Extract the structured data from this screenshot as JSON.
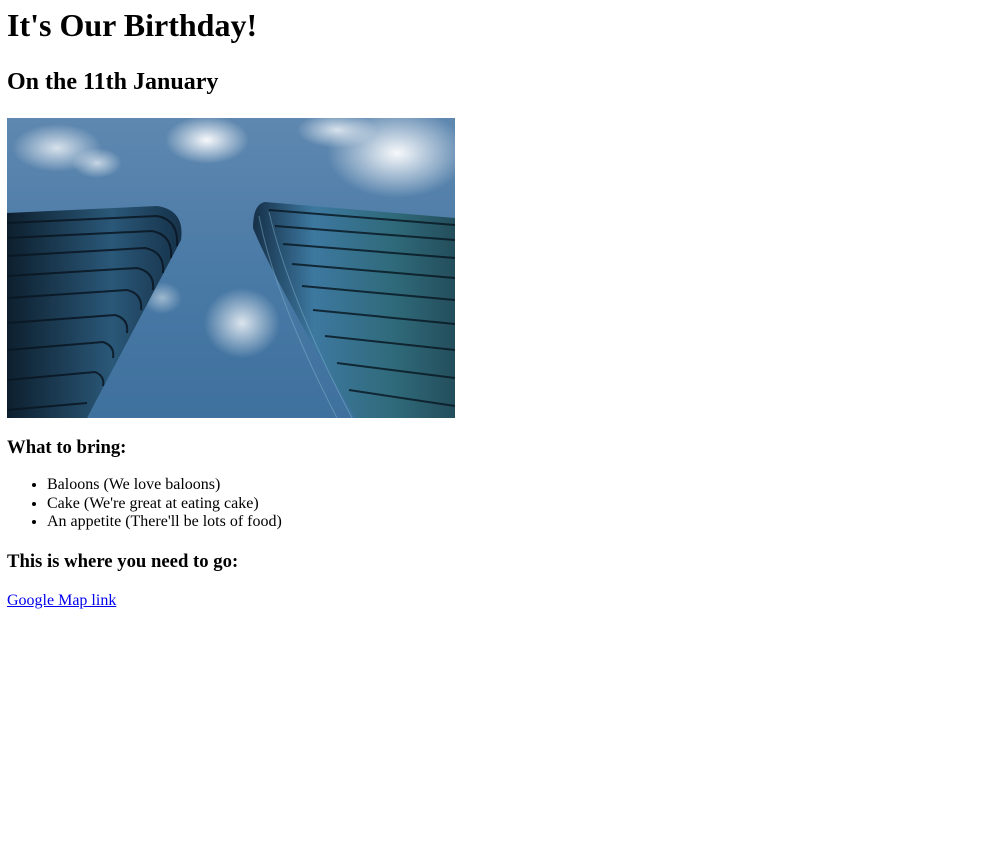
{
  "page": {
    "title": "It's Our Birthday!",
    "subtitle": "On the 11th January",
    "hero_image_icon": "skyscrapers-photo"
  },
  "bring": {
    "heading": "What to bring:",
    "items": [
      "Baloons (We love baloons)",
      "Cake (We're great at eating cake)",
      "An appetite (There'll be lots of food)"
    ]
  },
  "location": {
    "heading": "This is where you need to go:",
    "link_text": "Google Map link"
  },
  "colors": {
    "link": "#0000ee",
    "text": "#000000",
    "background": "#ffffff"
  }
}
